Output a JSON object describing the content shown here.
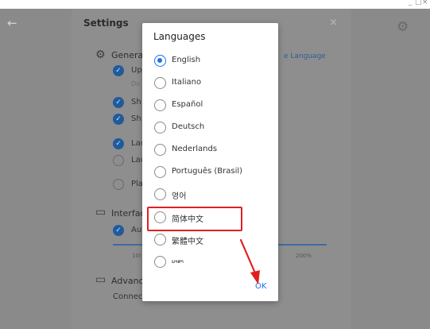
{
  "window": {
    "min": "_",
    "max": "□",
    "close": "×"
  },
  "nav": {
    "back_icon": "←",
    "gear_icon": "⚙"
  },
  "settings": {
    "title": "Settings",
    "close": "×",
    "general": {
      "icon": "⚙",
      "label": "Genera",
      "change_language_link": "e Language",
      "rows": [
        {
          "text": "Up",
          "checked": true
        },
        {
          "text": "Do",
          "checked": null
        },
        {
          "text": "Sh",
          "checked": true
        },
        {
          "text": "Sh",
          "checked": true
        },
        {
          "text": "Lau",
          "checked": true
        },
        {
          "text": "Lau",
          "checked": false
        },
        {
          "text": "Pla",
          "checked": false
        }
      ]
    },
    "interface": {
      "icon": "▭",
      "label": "Interfac",
      "row": "Aut",
      "pct_left": "10(",
      "pct_right": "200%"
    },
    "advanced": {
      "icon": "▭",
      "label": "Advanc",
      "row": "Connect"
    }
  },
  "dialog": {
    "title": "Languages",
    "items": [
      {
        "label": "English",
        "selected": true
      },
      {
        "label": "Italiano",
        "selected": false
      },
      {
        "label": "Español",
        "selected": false
      },
      {
        "label": "Deutsch",
        "selected": false
      },
      {
        "label": "Nederlands",
        "selected": false
      },
      {
        "label": "Português (Brasil)",
        "selected": false
      },
      {
        "label": "영어",
        "selected": false
      },
      {
        "label": "简体中文",
        "selected": false
      },
      {
        "label": "繁體中文",
        "selected": false
      },
      {
        "label": "ພາສາ",
        "selected": false
      }
    ],
    "ok": "OK"
  },
  "colors": {
    "accent": "#1a73e8",
    "highlight": "#e02020"
  }
}
